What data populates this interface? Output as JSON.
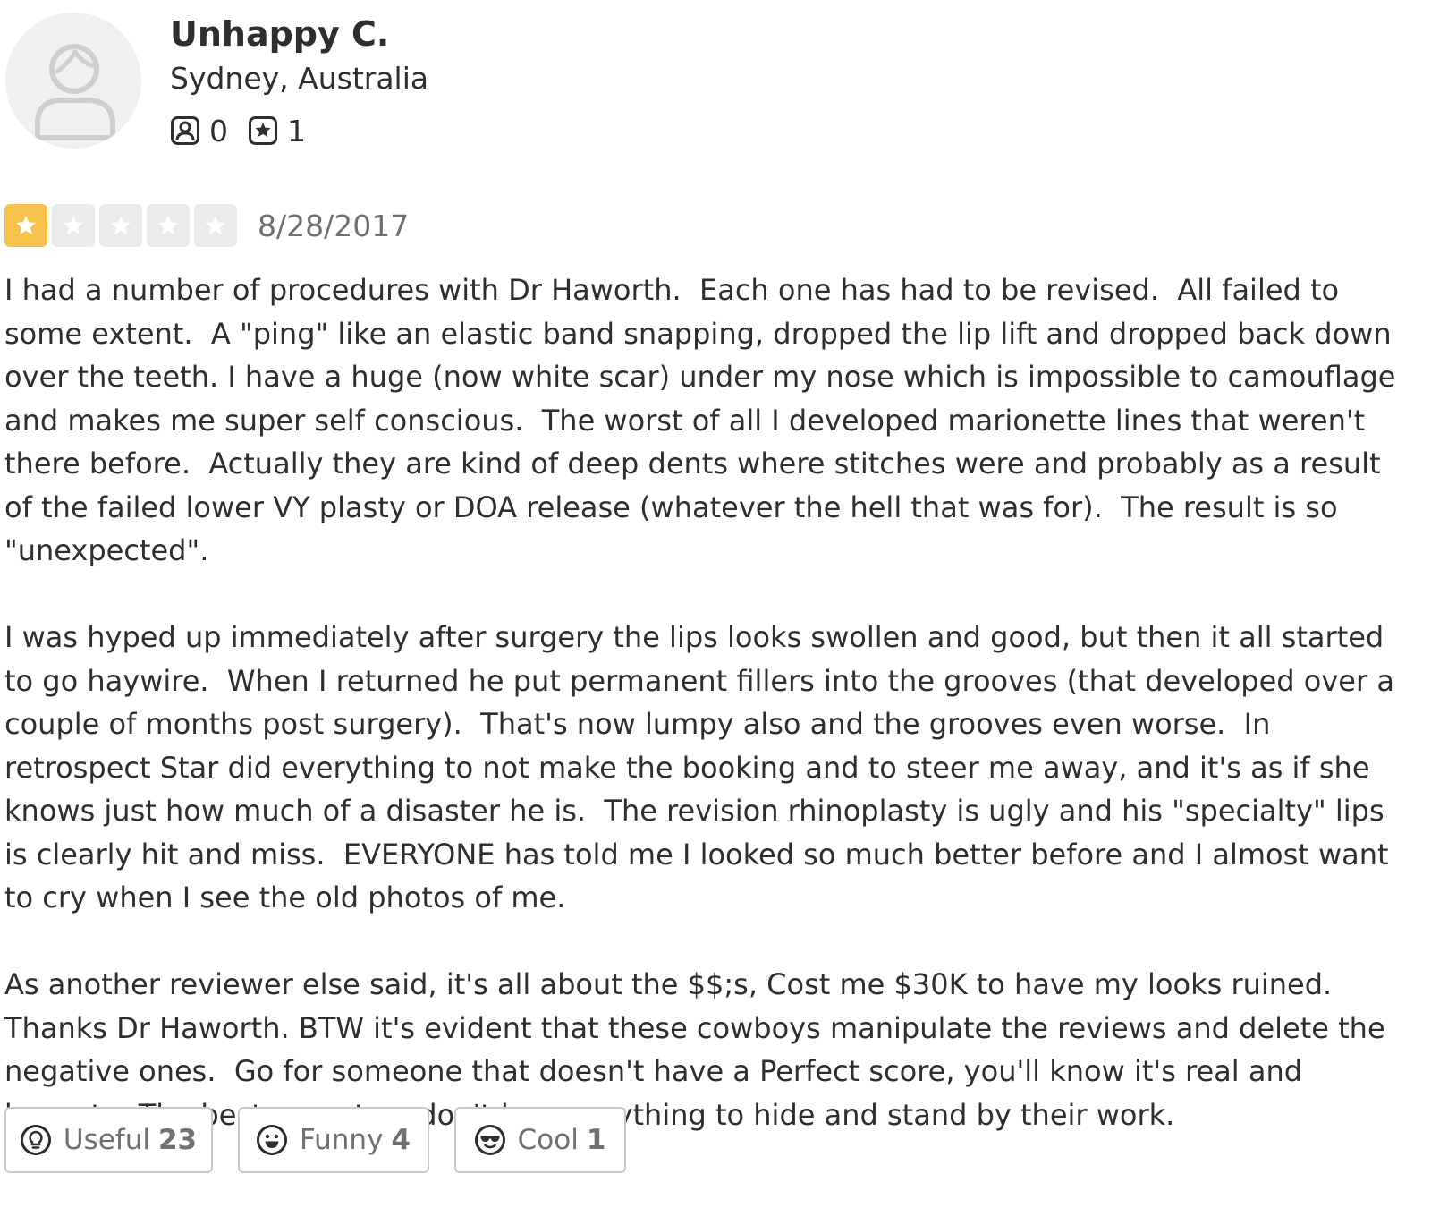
{
  "user": {
    "name": "Unhappy C.",
    "location": "Sydney, Australia",
    "friends_count": "0",
    "reviews_count": "1"
  },
  "review": {
    "rating": 1,
    "max_rating": 5,
    "date": "8/28/2017",
    "paragraphs": [
      "I had a number of procedures with Dr Haworth.  Each one has had to be revised.  All failed to some extent.  A \"ping\" like an elastic band snapping, dropped the lip lift and dropped back down over the teeth. I have a huge (now white scar) under my nose which is impossible to camouflage and makes me super self conscious.  The worst of all I developed marionette lines that weren't there before.  Actually they are kind of deep dents where stitches were and probably as a result of the failed lower VY plasty or DOA release (whatever the hell that was for).  The result is so \"unexpected\".",
      "I was hyped up immediately after surgery the lips looks swollen and good, but then it all started to go haywire.  When I returned he put permanent fillers into the grooves (that developed over a couple of months post surgery).  That's now lumpy also and the grooves even worse.  In retrospect Star did everything to not make the booking and to steer me away, and it's as if she knows just how much of a disaster he is.  The revision rhinoplasty is ugly and his \"specialty\" lips is clearly hit and miss.  EVERYONE has told me I looked so much better before and I almost want to cry when I see the old photos of me.",
      "As another reviewer else said, it's all about the $$;s, Cost me $30K to have my looks ruined.  Thanks Dr Haworth. BTW it's evident that these cowboys manipulate the reviews and delete the negative ones.  Go for someone that doesn't have a Perfect score, you'll know it's real and honest.   The best operators don't have anything to hide and stand by their work."
    ]
  },
  "reactions": {
    "useful": {
      "label": "Useful",
      "count": "23",
      "icon": "lightbulb-icon"
    },
    "funny": {
      "label": "Funny",
      "count": "4",
      "icon": "smiley-face-icon"
    },
    "cool": {
      "label": "Cool",
      "count": "1",
      "icon": "sunglasses-face-icon"
    }
  },
  "colors": {
    "star_filled": "#f5c34b",
    "star_empty": "#ebebeb",
    "text": "#2d2e2f",
    "muted": "#6e7072",
    "border": "#c8c9ca"
  }
}
